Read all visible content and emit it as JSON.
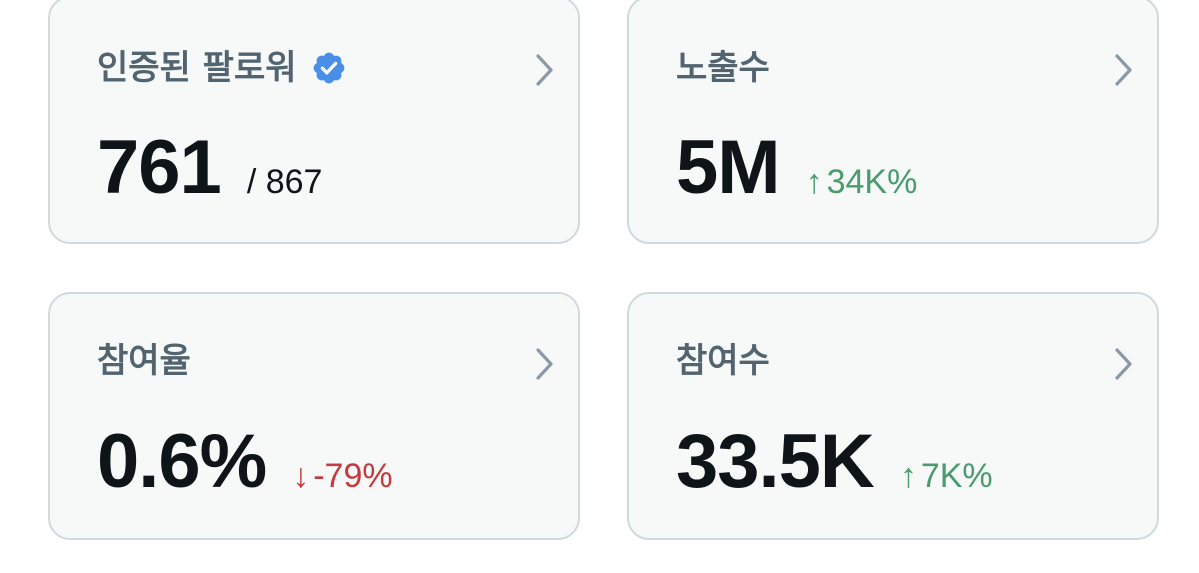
{
  "cards": [
    {
      "title": "인증된 팔로워",
      "value": "761",
      "total": "/ 867",
      "verified_icon": "verified-badge-icon",
      "chevron_icon": "chevron-right-icon"
    },
    {
      "title": "노출수",
      "value": "5M",
      "change_arrow": "↑",
      "change": "34K%",
      "change_direction": "up",
      "chevron_icon": "chevron-right-icon"
    },
    {
      "title": "참여율",
      "value": "0.6%",
      "change_arrow": "↓",
      "change": "-79%",
      "change_direction": "down",
      "chevron_icon": "chevron-right-icon"
    },
    {
      "title": "참여수",
      "value": "33.5K",
      "change_arrow": "↑",
      "change": "7K%",
      "change_direction": "up",
      "chevron_icon": "chevron-right-icon"
    }
  ],
  "colors": {
    "card_background": "#f7f9f9",
    "card_border": "#cfd9de",
    "title": "#536471",
    "value": "#0f1419",
    "positive": "#4a9b6e",
    "negative": "#c53a3e",
    "verified": "#4a8fe7",
    "chevron": "#8b98a5"
  }
}
